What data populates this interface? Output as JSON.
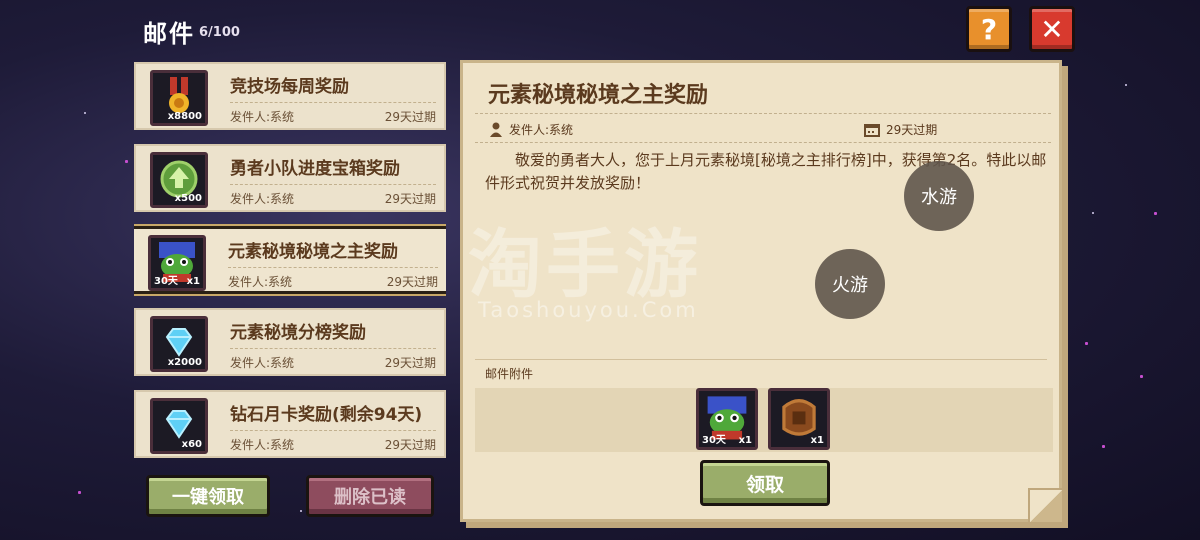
{
  "header": {
    "title": "邮件",
    "count": "6/100"
  },
  "mail_items": [
    {
      "title": "竞技场每周奖励",
      "sender": "发件人:系统",
      "expiry": "29天过期",
      "qty": "x8800",
      "icon": "medal-icon"
    },
    {
      "title": "勇者小队进度宝箱奖励",
      "sender": "发件人:系统",
      "expiry": "29天过期",
      "qty": "x500",
      "icon": "green-arrow-token-icon"
    },
    {
      "title": "元素秘境秘境之主奖励",
      "sender": "发件人:系统",
      "expiry": "29天过期",
      "qty": "x1",
      "days": "30天",
      "icon": "frog-avatar-icon",
      "selected": true
    },
    {
      "title": "元素秘境分榜奖励",
      "sender": "发件人:系统",
      "expiry": "29天过期",
      "qty": "x2000",
      "icon": "diamond-icon"
    },
    {
      "title": "钻石月卡奖励(剩余94天)",
      "sender": "发件人:系统",
      "expiry": "29天过期",
      "qty": "x60",
      "icon": "diamond-icon"
    }
  ],
  "buttons": {
    "claim_all": "一键领取",
    "delete_read": "删除已读",
    "claim": "领取",
    "help": "?",
    "close": "✕"
  },
  "detail": {
    "title": "元素秘境秘境之主奖励",
    "sender": "发件人:系统",
    "expiry": "29天过期",
    "body": "敬爱的勇者大人，您于上月元素秘境[秘境之主排行榜]中，获得第2名。特此以邮件形式祝贺并发放奖励！",
    "attachments_label": "邮件附件",
    "attachments": [
      {
        "icon": "frog-avatar-icon",
        "qty": "x1",
        "days": "30天"
      },
      {
        "icon": "helmet-frame-icon",
        "qty": "x1"
      }
    ]
  },
  "watermark": {
    "main": "淘手游",
    "sub": "Taoshouyou.Com",
    "bubble_water": "水游",
    "bubble_fire": "火游"
  },
  "colors": {
    "panel": "#efe3c8",
    "text": "#5b3a1e",
    "help": "#e8902c",
    "close": "#d83a2e",
    "green_button": "#9aad6a",
    "red_button": "#8e4c5e"
  }
}
